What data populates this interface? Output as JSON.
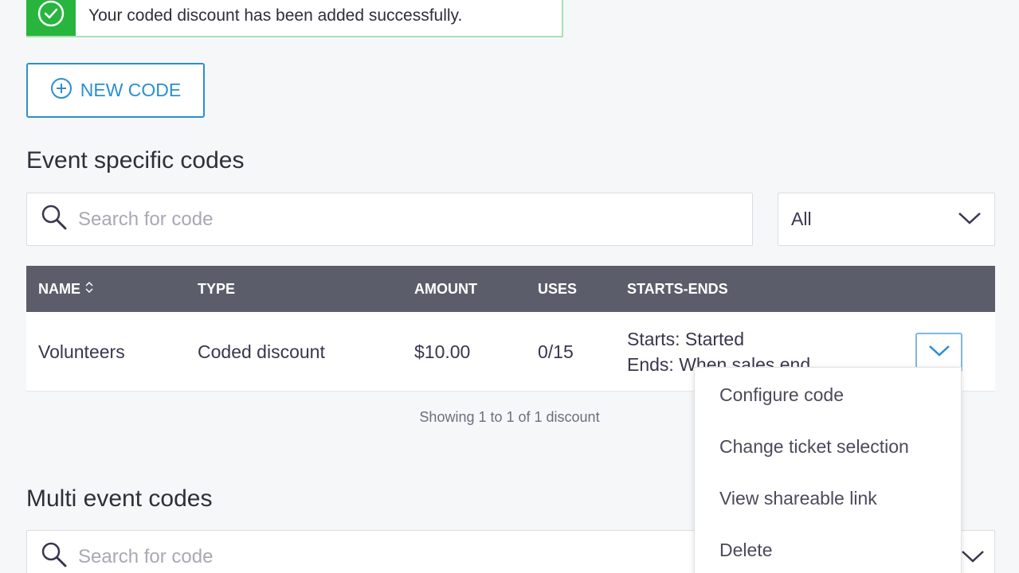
{
  "toast": {
    "message": "Your coded discount has been added successfully."
  },
  "actions": {
    "new_code_label": "NEW CODE"
  },
  "event_codes": {
    "title": "Event specific codes",
    "search_placeholder": "Search for code",
    "filter_value": "All",
    "columns": [
      "NAME",
      "TYPE",
      "AMOUNT",
      "USES",
      "STARTS-ENDS"
    ],
    "rows": [
      {
        "name": "Volunteers",
        "type": "Coded discount",
        "amount": "$10.00",
        "uses": "0/15",
        "starts": "Starts: Started",
        "ends": "Ends: When sales end"
      }
    ],
    "showing": "Showing 1 to 1 of 1 discount"
  },
  "row_menu": {
    "items": [
      "Configure code",
      "Change ticket selection",
      "View shareable link",
      "Delete"
    ]
  },
  "multi_event_codes": {
    "title": "Multi event codes",
    "search_placeholder": "Search for code"
  },
  "colors": {
    "success": "#27b53e",
    "accent": "#2b8fd1",
    "table_header": "#5b5e6a"
  },
  "icons": {
    "toast": "check-circle-icon",
    "new_code": "plus-circle-icon",
    "search": "search-icon",
    "select": "chevron-down-icon",
    "sort": "sort-icon"
  }
}
